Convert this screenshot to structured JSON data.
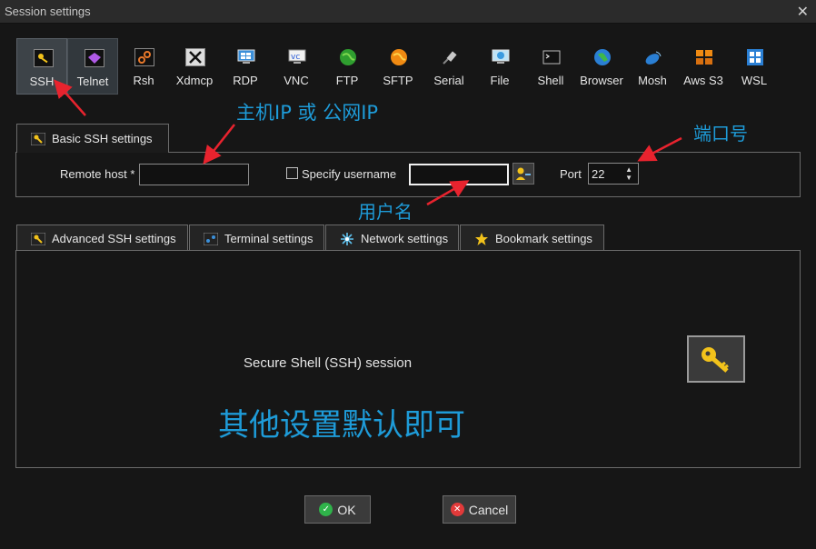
{
  "window": {
    "title": "Session settings",
    "close_glyph": "✕"
  },
  "protocols": [
    {
      "label": "SSH",
      "icon": "ssh-key-icon",
      "state": "active"
    },
    {
      "label": "Telnet",
      "icon": "telnet-gem-icon",
      "state": "selected"
    },
    {
      "label": "Rsh",
      "icon": "rsh-icon"
    },
    {
      "label": "Xdmcp",
      "icon": "xdmcp-x-icon"
    },
    {
      "label": "RDP",
      "icon": "rdp-monitor-icon"
    },
    {
      "label": "VNC",
      "icon": "vnc-monitor-icon"
    },
    {
      "label": "FTP",
      "icon": "ftp-globe-icon"
    },
    {
      "label": "SFTP",
      "icon": "sftp-globe-icon"
    },
    {
      "label": "Serial",
      "icon": "serial-plug-icon"
    },
    {
      "label": "File",
      "icon": "file-monitor-icon"
    },
    {
      "label": "Shell",
      "icon": "shell-terminal-icon"
    },
    {
      "label": "Browser",
      "icon": "browser-globe-icon"
    },
    {
      "label": "Mosh",
      "icon": "mosh-dish-icon"
    },
    {
      "label": "Aws S3",
      "icon": "aws-s3-boxes-icon"
    },
    {
      "label": "WSL",
      "icon": "wsl-windows-icon"
    }
  ],
  "basic": {
    "tab_label": "Basic SSH settings",
    "remote_host_label": "Remote host *",
    "remote_host_value": "",
    "specify_username_label": "Specify username",
    "specify_username_checked": false,
    "username_value": "",
    "port_label": "Port",
    "port_value": "22"
  },
  "sub_tabs": [
    {
      "label": "Advanced SSH settings",
      "icon": "key-icon"
    },
    {
      "label": "Terminal settings",
      "icon": "terminal-icon"
    },
    {
      "label": "Network settings",
      "icon": "network-icon"
    },
    {
      "label": "Bookmark settings",
      "icon": "star-icon"
    }
  ],
  "panel": {
    "description": "Secure Shell (SSH) session"
  },
  "buttons": {
    "ok": "OK",
    "cancel": "Cancel"
  },
  "annotations": {
    "remote_host_hint": "主机IP 或 公网IP",
    "port_hint": "端口号",
    "username_hint": "用户名",
    "default_hint": "其他设置默认即可"
  },
  "colors": {
    "annotation": "#1e9bd8",
    "arrow": "#e8232e",
    "background": "#161616"
  }
}
